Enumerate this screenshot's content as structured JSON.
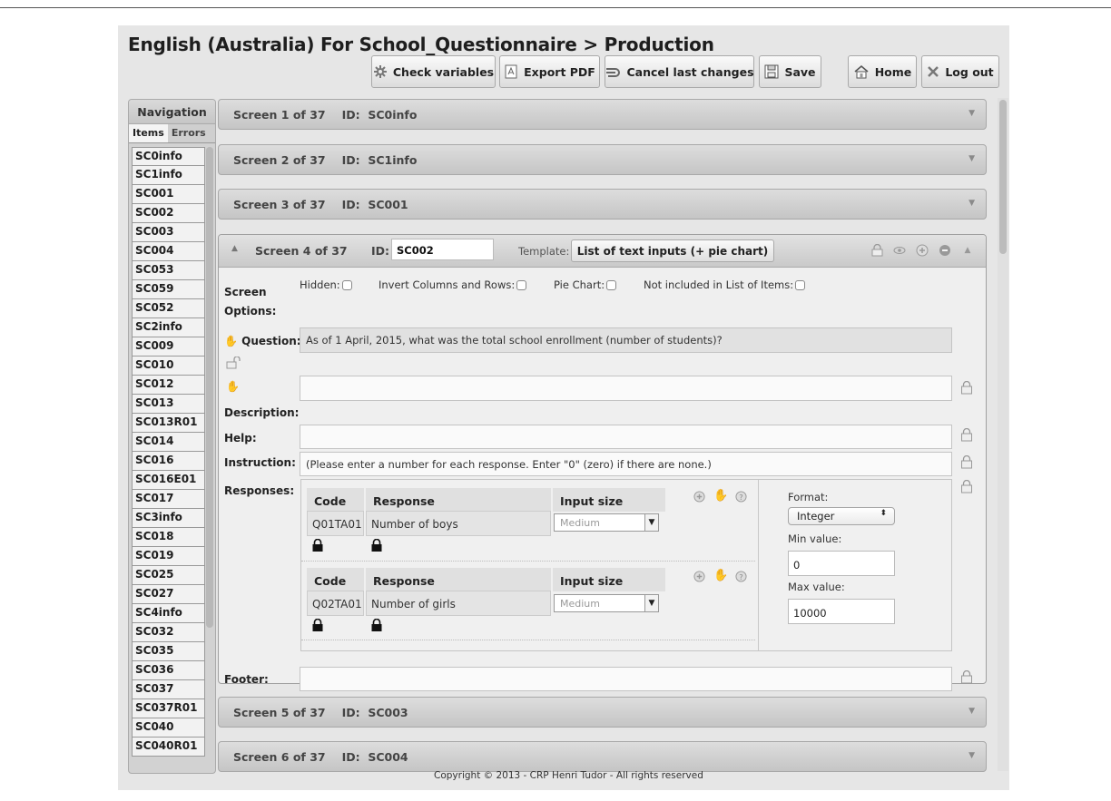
{
  "header": {
    "title": "English (Australia) For School_Questionnaire > Production",
    "buttons": {
      "check": "Check variables",
      "export": "Export PDF",
      "cancel": "Cancel last changes",
      "save": "Save",
      "home": "Home",
      "logout": "Log out"
    }
  },
  "navigation": {
    "title": "Navigation",
    "tabs": [
      "Items",
      "Errors"
    ],
    "items": [
      "SC0info",
      "SC1info",
      "SC001",
      "SC002",
      "SC003",
      "SC004",
      "SC053",
      "SC059",
      "SC052",
      "SC2info",
      "SC009",
      "SC010",
      "SC012",
      "SC013",
      "SC013R01",
      "SC014",
      "SC016",
      "SC016E01",
      "SC017",
      "SC3info",
      "SC018",
      "SC019",
      "SC025",
      "SC027",
      "SC4info",
      "SC032",
      "SC035",
      "SC036",
      "SC037",
      "SC037R01",
      "SC040",
      "SC040R01"
    ]
  },
  "screens": [
    {
      "label": "Screen 1 of 37",
      "id_label": "ID:",
      "id": "SC0info"
    },
    {
      "label": "Screen 2 of 37",
      "id_label": "ID:",
      "id": "SC1info"
    },
    {
      "label": "Screen 3 of 37",
      "id_label": "ID:",
      "id": "SC001"
    },
    {
      "label": "Screen 5 of 37",
      "id_label": "ID:",
      "id": "SC003"
    },
    {
      "label": "Screen 6 of 37",
      "id_label": "ID:",
      "id": "SC004"
    }
  ],
  "open_screen": {
    "label": "Screen 4 of 37",
    "id_label": "ID:",
    "id_value": "SC002",
    "template_label": "Template:",
    "template_value": "List of text inputs (+ pie chart)",
    "options_label_1": "Screen",
    "options_label_2": "Options:",
    "options": {
      "hidden": "Hidden:",
      "invert": "Invert Columns and Rows:",
      "pie": "Pie Chart:",
      "not_included": "Not included in List of Items:"
    },
    "question_label": "Question:",
    "question_text": "As of 1 April, 2015, what was the total school enrollment (number of students)?",
    "description_label": "Description:",
    "help_label": "Help:",
    "instruction_label": "Instruction:",
    "instruction_text": "(Please enter a number for each response. Enter \"0\" (zero) if there are none.)",
    "responses_label": "Responses:",
    "footer_label": "Footer:",
    "table_headers": {
      "code": "Code",
      "response": "Response",
      "input_size": "Input size"
    },
    "responses": [
      {
        "code": "Q01TA01",
        "response": "Number of boys",
        "input_size": "Medium"
      },
      {
        "code": "Q02TA01",
        "response": "Number of girls",
        "input_size": "Medium"
      }
    ],
    "format_label": "Format:",
    "format_value": "Integer",
    "min_label": "Min value:",
    "min_value": "0",
    "max_label": "Max value:",
    "max_value": "10000"
  },
  "copyright": "Copyright © 2013 - CRP Henri Tudor - All rights reserved"
}
